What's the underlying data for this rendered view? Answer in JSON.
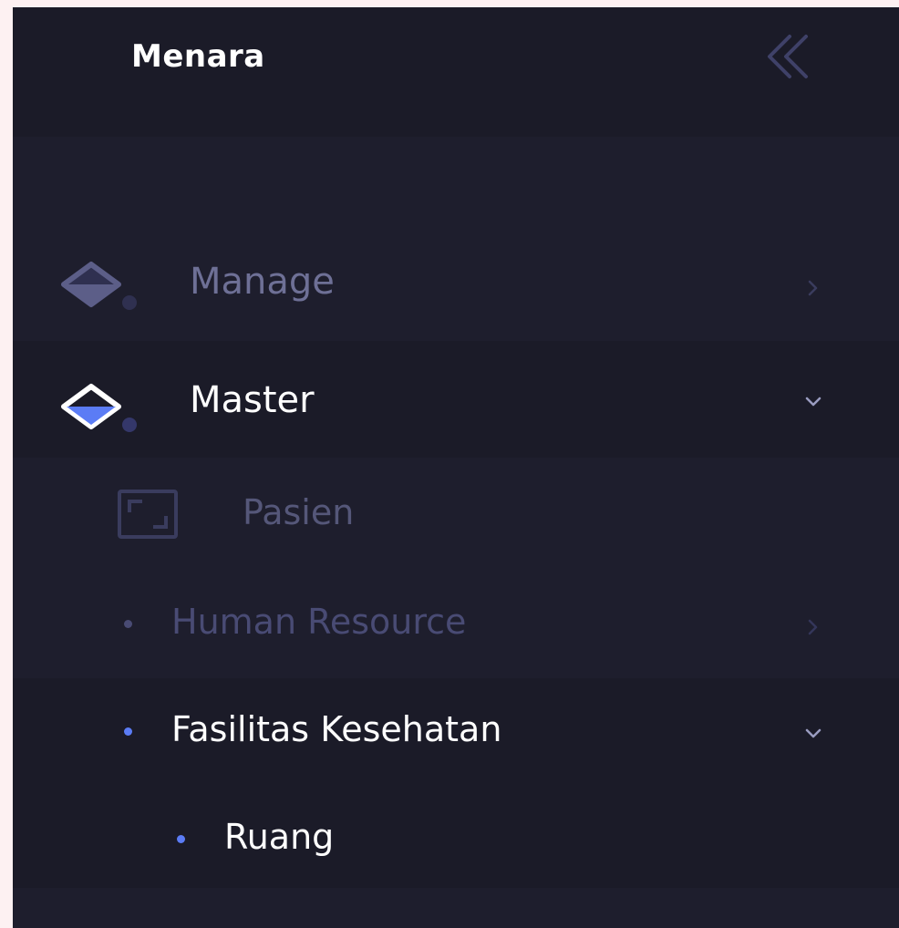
{
  "brand": {
    "name": "Menara"
  },
  "colors": {
    "sidebar_bg": "#1e1e2d",
    "active_accent": "#5b7cf5",
    "active_text": "#ffffff",
    "muted_text": "#494b74",
    "page_bg": "#fdf1f2"
  },
  "menu": {
    "manage": {
      "label": "Manage",
      "icon": "layers-icon",
      "state": "collapsed"
    },
    "master": {
      "label": "Master",
      "icon": "layers-icon",
      "state": "expanded",
      "active": true
    },
    "pasien": {
      "label": "Pasien",
      "icon": "frame-icon"
    },
    "human_resource": {
      "label": "Human Resource",
      "state": "collapsed"
    },
    "fasilitas_kesehatan": {
      "label": "Fasilitas Kesehatan",
      "state": "expanded",
      "active": true
    },
    "ruang": {
      "label": "Ruang",
      "active": true
    }
  }
}
